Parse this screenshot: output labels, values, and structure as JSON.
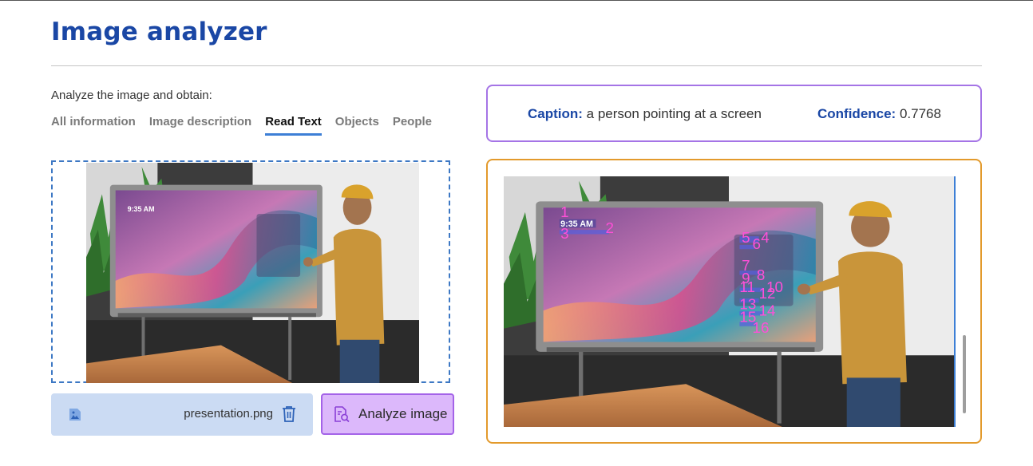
{
  "page": {
    "title": "Image analyzer"
  },
  "options": {
    "prompt": "Analyze the image and obtain:",
    "tabs": [
      {
        "label": "All information",
        "active": false
      },
      {
        "label": "Image description",
        "active": false
      },
      {
        "label": "Read Text",
        "active": true
      },
      {
        "label": "Objects",
        "active": false
      },
      {
        "label": "People",
        "active": false
      }
    ]
  },
  "upload": {
    "file_name": "presentation.png",
    "screen_time": "9:35 AM",
    "analyze_label": "Analyze image"
  },
  "result": {
    "caption_key": "Caption:",
    "caption_value": "a person pointing at a screen",
    "confidence_key": "Confidence:",
    "confidence_value": "0.7768",
    "detected_time": "9:35 AM",
    "text_region_numbers": [
      "1",
      "2",
      "3",
      "4",
      "5",
      "6",
      "7",
      "8",
      "9",
      "10",
      "11",
      "12",
      "13",
      "14",
      "15",
      "16"
    ]
  },
  "colors": {
    "title": "#1a47a5",
    "tab_underline": "#3d7fd6",
    "caption_border": "#a574e6",
    "result_border": "#e39a2c",
    "analyze_fill": "#dcb8fb",
    "file_bar_fill": "#cbdbf3",
    "ocr_overlay": "#ff4fd8"
  },
  "icons": {
    "file": "image-file-icon",
    "delete": "trash-icon",
    "analyze": "document-search-icon"
  }
}
